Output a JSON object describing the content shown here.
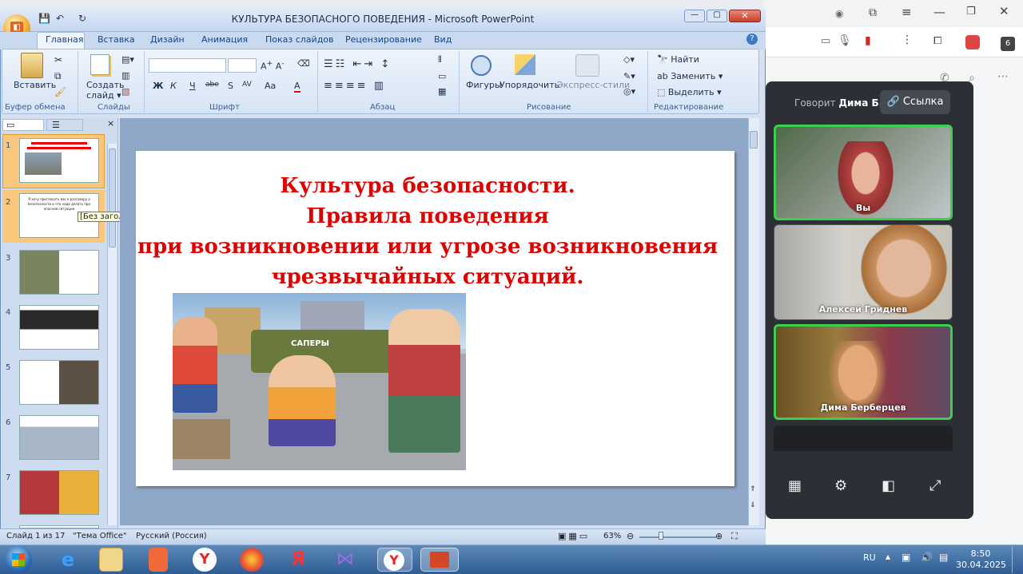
{
  "ppt": {
    "title": "КУЛЬТУРА БЕЗОПАСНОГО ПОВЕДЕНИЯ - Microsoft PowerPoint",
    "tabs": [
      "Главная",
      "Вставка",
      "Дизайн",
      "Анимация",
      "Показ слайдов",
      "Рецензирование",
      "Вид"
    ],
    "groups": {
      "clipboard": "Буфер обмена",
      "slides": "Слайды",
      "font": "Шрифт",
      "paragraph": "Абзац",
      "drawing": "Рисование",
      "editing": "Редактирование"
    },
    "buttons": {
      "paste": "Вставить",
      "create_slide": "Создать",
      "create_slide2": "слайд",
      "shapes": "Фигуры",
      "arrange": "Упорядочить",
      "quick_styles": "Экспресс-стили",
      "find": "Найти",
      "replace": "Заменить",
      "select": "Выделить"
    },
    "font_buttons": [
      "Ж",
      "К",
      "Ч",
      "abe",
      "S",
      "AV",
      "Aa",
      "A"
    ],
    "tooltip": "[Без заголовка]",
    "slide_numbers": [
      "1",
      "2",
      "3",
      "4",
      "5",
      "6",
      "7"
    ],
    "thumb2_text": "Я хочу пригласить вас к разговору о безопасности и что надо делать при опасной ситуации",
    "slide": {
      "title_lines": [
        "Культура безопасности.",
        "Правила поведения",
        "при возникновении или угрозе возникновения",
        "чрезвычайных  ситуаций."
      ],
      "truck_label": "САПЕРЫ"
    },
    "status": {
      "slide_counter": "Слайд 1 из 17",
      "theme": "\"Тема Office\"",
      "language": "Русский (Россия)",
      "zoom": "63%"
    }
  },
  "meet": {
    "speaker_prefix": "Говорит",
    "speaker_name": "Дима Б.",
    "link_button": "Ссылка",
    "participants": [
      "Вы",
      "Алексей Гриднев",
      "Дима Берберцев"
    ]
  },
  "taskbar": {
    "lang": "RU",
    "time": "8:50",
    "date": "30.04.2025"
  },
  "colors": {
    "title_red": "#e00000",
    "active_speaker": "#3ccf4e"
  }
}
